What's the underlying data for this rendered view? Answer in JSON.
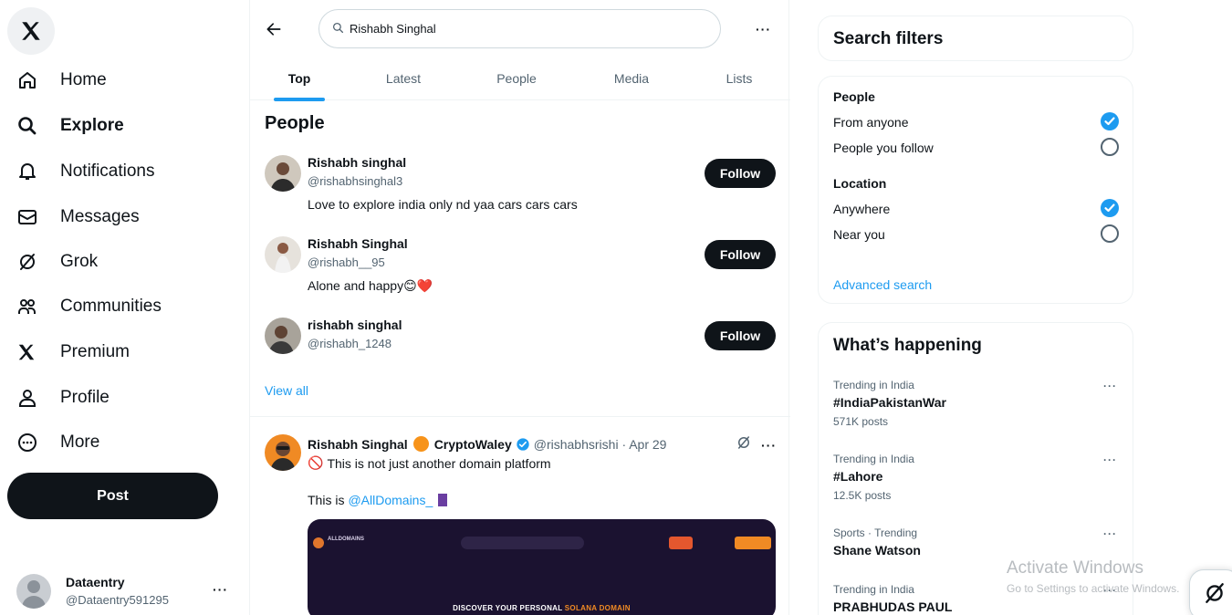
{
  "sidebar": {
    "logo_icon": "x-logo-icon",
    "items": [
      {
        "label": "Home",
        "icon": "home-icon",
        "active": false
      },
      {
        "label": "Explore",
        "icon": "search-icon",
        "active": true
      },
      {
        "label": "Notifications",
        "icon": "bell-icon",
        "active": false
      },
      {
        "label": "Messages",
        "icon": "envelope-icon",
        "active": false
      },
      {
        "label": "Grok",
        "icon": "grok-icon",
        "active": false
      },
      {
        "label": "Communities",
        "icon": "people-icon",
        "active": false
      },
      {
        "label": "Premium",
        "icon": "x-logo-icon",
        "active": false
      },
      {
        "label": "Profile",
        "icon": "person-icon",
        "active": false
      },
      {
        "label": "More",
        "icon": "more-circle-icon",
        "active": false
      }
    ],
    "post_label": "Post",
    "account": {
      "name": "Dataentry",
      "handle": "@Dataentry591295",
      "more": "···"
    }
  },
  "search": {
    "query": "Rishabh Singhal",
    "more": "···"
  },
  "tabs": [
    {
      "label": "Top",
      "active": true
    },
    {
      "label": "Latest",
      "active": false
    },
    {
      "label": "People",
      "active": false
    },
    {
      "label": "Media",
      "active": false
    },
    {
      "label": "Lists",
      "active": false
    }
  ],
  "people": {
    "title": "People",
    "follow_label": "Follow",
    "items": [
      {
        "name": "Rishabh singhal",
        "handle": "@rishabhsinghal3",
        "bio": "Love to explore india only nd yaa cars cars cars"
      },
      {
        "name": "Rishabh Singhal",
        "handle": "@rishabh__95",
        "bio": "Alone and happy",
        "bio_emoji": "😊❤️"
      },
      {
        "name": "rishabh singhal",
        "handle": "@rishabh_1248",
        "bio": ""
      }
    ],
    "view_all": "View all"
  },
  "tweet": {
    "name": "Rishabh Singhal",
    "org": "CryptoWaley",
    "handle": "@rishabhsrishi · Apr 29",
    "more": "···",
    "line1": "This is not just another domain platform",
    "line1_prefix": "🚫",
    "line2_prefix": "This is",
    "mention": "@AllDomains_",
    "media": {
      "brand": "ALLDOMAINS",
      "headline_pre": "DISCOVER YOUR PERSONAL",
      "headline_hl": "SOLANA DOMAIN"
    }
  },
  "filters": {
    "title": "Search filters",
    "people_heading": "People",
    "people_options": [
      {
        "label": "From anyone",
        "checked": true
      },
      {
        "label": "People you follow",
        "checked": false
      }
    ],
    "location_heading": "Location",
    "location_options": [
      {
        "label": "Anywhere",
        "checked": true
      },
      {
        "label": "Near you",
        "checked": false
      }
    ],
    "advanced": "Advanced search"
  },
  "happening": {
    "title": "What’s happening",
    "trends": [
      {
        "context": "Trending in India",
        "title": "#IndiaPakistanWar",
        "count": "571K posts"
      },
      {
        "context": "Trending in India",
        "title": "#Lahore",
        "count": "12.5K posts"
      },
      {
        "context": "Sports · Trending",
        "title": "Shane Watson",
        "count": ""
      },
      {
        "context": "Trending in India",
        "title": "PRABHUDAS PAUL",
        "count": ""
      }
    ],
    "more": "···"
  },
  "watermark": {
    "title": "Activate Windows",
    "subtitle": "Go to Settings to activate Windows."
  },
  "colors": {
    "accent": "#1d9bf0",
    "text": "#0f1419",
    "muted": "#536471",
    "button": "#0f1419"
  }
}
